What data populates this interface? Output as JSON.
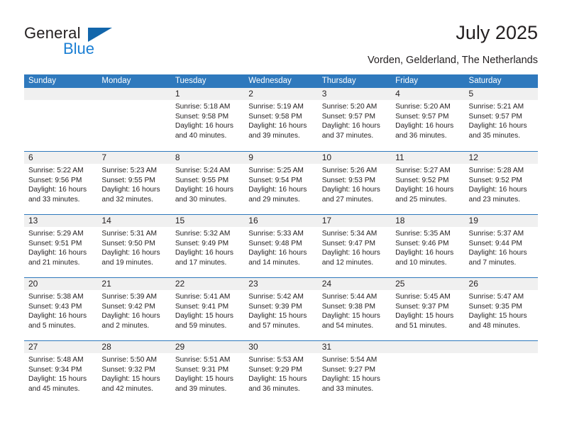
{
  "brand": {
    "name_part1": "General",
    "name_part2": "Blue",
    "triangle_color": "#1266ab",
    "blue_color": "#1b7fd4"
  },
  "header": {
    "title": "July 2025",
    "subtitle": "Vorden, Gelderland, The Netherlands"
  },
  "theme": {
    "header_blue": "#2f79bd",
    "daynum_band": "#f0f0f0",
    "text": "#231f20"
  },
  "weekdays": [
    "Sunday",
    "Monday",
    "Tuesday",
    "Wednesday",
    "Thursday",
    "Friday",
    "Saturday"
  ],
  "weeks": [
    [
      {
        "day": ""
      },
      {
        "day": ""
      },
      {
        "day": "1",
        "sunrise": "Sunrise: 5:18 AM",
        "sunset": "Sunset: 9:58 PM",
        "daylight_line1": "Daylight: 16 hours",
        "daylight_line2": "and 40 minutes."
      },
      {
        "day": "2",
        "sunrise": "Sunrise: 5:19 AM",
        "sunset": "Sunset: 9:58 PM",
        "daylight_line1": "Daylight: 16 hours",
        "daylight_line2": "and 39 minutes."
      },
      {
        "day": "3",
        "sunrise": "Sunrise: 5:20 AM",
        "sunset": "Sunset: 9:57 PM",
        "daylight_line1": "Daylight: 16 hours",
        "daylight_line2": "and 37 minutes."
      },
      {
        "day": "4",
        "sunrise": "Sunrise: 5:20 AM",
        "sunset": "Sunset: 9:57 PM",
        "daylight_line1": "Daylight: 16 hours",
        "daylight_line2": "and 36 minutes."
      },
      {
        "day": "5",
        "sunrise": "Sunrise: 5:21 AM",
        "sunset": "Sunset: 9:57 PM",
        "daylight_line1": "Daylight: 16 hours",
        "daylight_line2": "and 35 minutes."
      }
    ],
    [
      {
        "day": "6",
        "sunrise": "Sunrise: 5:22 AM",
        "sunset": "Sunset: 9:56 PM",
        "daylight_line1": "Daylight: 16 hours",
        "daylight_line2": "and 33 minutes."
      },
      {
        "day": "7",
        "sunrise": "Sunrise: 5:23 AM",
        "sunset": "Sunset: 9:55 PM",
        "daylight_line1": "Daylight: 16 hours",
        "daylight_line2": "and 32 minutes."
      },
      {
        "day": "8",
        "sunrise": "Sunrise: 5:24 AM",
        "sunset": "Sunset: 9:55 PM",
        "daylight_line1": "Daylight: 16 hours",
        "daylight_line2": "and 30 minutes."
      },
      {
        "day": "9",
        "sunrise": "Sunrise: 5:25 AM",
        "sunset": "Sunset: 9:54 PM",
        "daylight_line1": "Daylight: 16 hours",
        "daylight_line2": "and 29 minutes."
      },
      {
        "day": "10",
        "sunrise": "Sunrise: 5:26 AM",
        "sunset": "Sunset: 9:53 PM",
        "daylight_line1": "Daylight: 16 hours",
        "daylight_line2": "and 27 minutes."
      },
      {
        "day": "11",
        "sunrise": "Sunrise: 5:27 AM",
        "sunset": "Sunset: 9:52 PM",
        "daylight_line1": "Daylight: 16 hours",
        "daylight_line2": "and 25 minutes."
      },
      {
        "day": "12",
        "sunrise": "Sunrise: 5:28 AM",
        "sunset": "Sunset: 9:52 PM",
        "daylight_line1": "Daylight: 16 hours",
        "daylight_line2": "and 23 minutes."
      }
    ],
    [
      {
        "day": "13",
        "sunrise": "Sunrise: 5:29 AM",
        "sunset": "Sunset: 9:51 PM",
        "daylight_line1": "Daylight: 16 hours",
        "daylight_line2": "and 21 minutes."
      },
      {
        "day": "14",
        "sunrise": "Sunrise: 5:31 AM",
        "sunset": "Sunset: 9:50 PM",
        "daylight_line1": "Daylight: 16 hours",
        "daylight_line2": "and 19 minutes."
      },
      {
        "day": "15",
        "sunrise": "Sunrise: 5:32 AM",
        "sunset": "Sunset: 9:49 PM",
        "daylight_line1": "Daylight: 16 hours",
        "daylight_line2": "and 17 minutes."
      },
      {
        "day": "16",
        "sunrise": "Sunrise: 5:33 AM",
        "sunset": "Sunset: 9:48 PM",
        "daylight_line1": "Daylight: 16 hours",
        "daylight_line2": "and 14 minutes."
      },
      {
        "day": "17",
        "sunrise": "Sunrise: 5:34 AM",
        "sunset": "Sunset: 9:47 PM",
        "daylight_line1": "Daylight: 16 hours",
        "daylight_line2": "and 12 minutes."
      },
      {
        "day": "18",
        "sunrise": "Sunrise: 5:35 AM",
        "sunset": "Sunset: 9:46 PM",
        "daylight_line1": "Daylight: 16 hours",
        "daylight_line2": "and 10 minutes."
      },
      {
        "day": "19",
        "sunrise": "Sunrise: 5:37 AM",
        "sunset": "Sunset: 9:44 PM",
        "daylight_line1": "Daylight: 16 hours",
        "daylight_line2": "and 7 minutes."
      }
    ],
    [
      {
        "day": "20",
        "sunrise": "Sunrise: 5:38 AM",
        "sunset": "Sunset: 9:43 PM",
        "daylight_line1": "Daylight: 16 hours",
        "daylight_line2": "and 5 minutes."
      },
      {
        "day": "21",
        "sunrise": "Sunrise: 5:39 AM",
        "sunset": "Sunset: 9:42 PM",
        "daylight_line1": "Daylight: 16 hours",
        "daylight_line2": "and 2 minutes."
      },
      {
        "day": "22",
        "sunrise": "Sunrise: 5:41 AM",
        "sunset": "Sunset: 9:41 PM",
        "daylight_line1": "Daylight: 15 hours",
        "daylight_line2": "and 59 minutes."
      },
      {
        "day": "23",
        "sunrise": "Sunrise: 5:42 AM",
        "sunset": "Sunset: 9:39 PM",
        "daylight_line1": "Daylight: 15 hours",
        "daylight_line2": "and 57 minutes."
      },
      {
        "day": "24",
        "sunrise": "Sunrise: 5:44 AM",
        "sunset": "Sunset: 9:38 PM",
        "daylight_line1": "Daylight: 15 hours",
        "daylight_line2": "and 54 minutes."
      },
      {
        "day": "25",
        "sunrise": "Sunrise: 5:45 AM",
        "sunset": "Sunset: 9:37 PM",
        "daylight_line1": "Daylight: 15 hours",
        "daylight_line2": "and 51 minutes."
      },
      {
        "day": "26",
        "sunrise": "Sunrise: 5:47 AM",
        "sunset": "Sunset: 9:35 PM",
        "daylight_line1": "Daylight: 15 hours",
        "daylight_line2": "and 48 minutes."
      }
    ],
    [
      {
        "day": "27",
        "sunrise": "Sunrise: 5:48 AM",
        "sunset": "Sunset: 9:34 PM",
        "daylight_line1": "Daylight: 15 hours",
        "daylight_line2": "and 45 minutes."
      },
      {
        "day": "28",
        "sunrise": "Sunrise: 5:50 AM",
        "sunset": "Sunset: 9:32 PM",
        "daylight_line1": "Daylight: 15 hours",
        "daylight_line2": "and 42 minutes."
      },
      {
        "day": "29",
        "sunrise": "Sunrise: 5:51 AM",
        "sunset": "Sunset: 9:31 PM",
        "daylight_line1": "Daylight: 15 hours",
        "daylight_line2": "and 39 minutes."
      },
      {
        "day": "30",
        "sunrise": "Sunrise: 5:53 AM",
        "sunset": "Sunset: 9:29 PM",
        "daylight_line1": "Daylight: 15 hours",
        "daylight_line2": "and 36 minutes."
      },
      {
        "day": "31",
        "sunrise": "Sunrise: 5:54 AM",
        "sunset": "Sunset: 9:27 PM",
        "daylight_line1": "Daylight: 15 hours",
        "daylight_line2": "and 33 minutes."
      },
      {
        "day": ""
      },
      {
        "day": ""
      }
    ]
  ]
}
